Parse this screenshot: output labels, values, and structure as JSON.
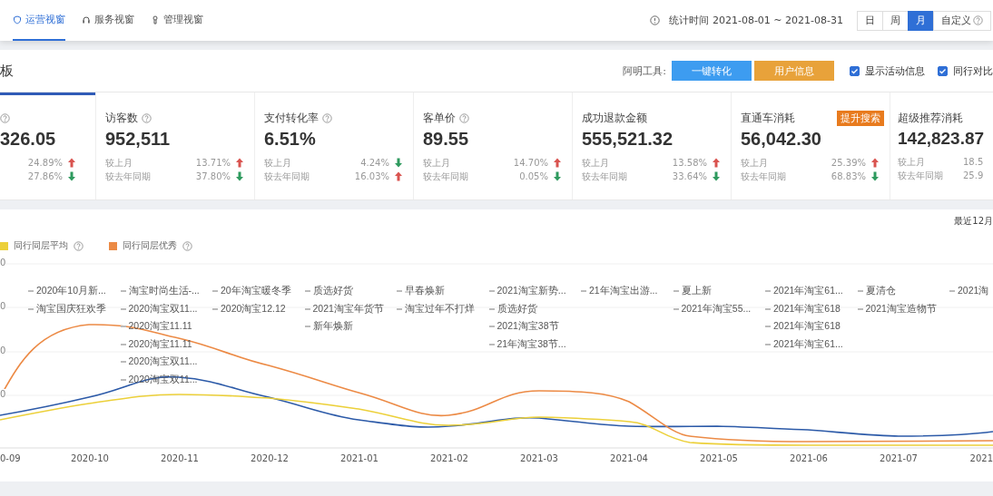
{
  "nav": {
    "tabs": [
      {
        "label": "运营视窗",
        "selected": true
      },
      {
        "label": "服务视窗",
        "selected": false
      },
      {
        "label": "管理视窗",
        "selected": false
      }
    ],
    "stat_time": "统计时间 2021-08-01 ~ 2021-08-31",
    "periods": [
      {
        "label": "日",
        "selected": false
      },
      {
        "label": "周",
        "selected": false
      },
      {
        "label": "月",
        "selected": true
      },
      {
        "label": "自定义",
        "selected": false
      }
    ]
  },
  "toolbar": {
    "title": "板",
    "tools_label": "阿明工具:",
    "buttons": [
      {
        "label": "一键转化",
        "kind": "primary"
      },
      {
        "label": "用户信息",
        "kind": "warning"
      }
    ],
    "checkboxes": [
      {
        "label": "显示活动信息",
        "checked": true
      },
      {
        "label": "同行对比",
        "checked": true
      }
    ]
  },
  "metrics": [
    {
      "selected": true,
      "value": "326.05",
      "rows": [
        {
          "value": "24.89%",
          "rising": true
        },
        {
          "value": "27.86%",
          "rising": false
        }
      ]
    },
    {
      "selected": false,
      "title": "访客数",
      "help": true,
      "value": "952,511",
      "rows": [
        {
          "label": "较上月",
          "value": "13.71%",
          "rising": true
        },
        {
          "label": "较去年同期",
          "value": "37.80%",
          "rising": false
        }
      ]
    },
    {
      "selected": false,
      "title": "支付转化率",
      "help": true,
      "value": "6.51%",
      "rows": [
        {
          "label": "较上月",
          "value": "4.24%",
          "rising": false
        },
        {
          "label": "较去年同期",
          "value": "16.03%",
          "rising": true
        }
      ]
    },
    {
      "selected": false,
      "title": "客单价",
      "help": true,
      "value": "89.55",
      "rows": [
        {
          "label": "较上月",
          "value": "14.70%",
          "rising": true
        },
        {
          "label": "较去年同期",
          "value": "0.05%",
          "rising": false
        }
      ]
    },
    {
      "selected": false,
      "title": "成功退款金额",
      "value": "555,521.32",
      "rows": [
        {
          "label": "较上月",
          "value": "13.58%",
          "rising": true
        },
        {
          "label": "较去年同期",
          "value": "33.64%",
          "rising": false
        }
      ]
    },
    {
      "selected": false,
      "title": "直通车消耗",
      "badge": "提升搜索",
      "value": "56,042.30",
      "rows": [
        {
          "label": "较上月",
          "value": "25.39%",
          "rising": true
        },
        {
          "label": "较去年同期",
          "value": "68.83%",
          "rising": false
        }
      ]
    },
    {
      "selected": false,
      "title": "超级推荐消耗",
      "value": "142,823.87",
      "rows": [
        {
          "label": "较上月",
          "value": "18.5"
        },
        {
          "label": "较去年同期",
          "value": "25.9"
        }
      ]
    }
  ],
  "chart": {
    "corner_label": "最近12月",
    "legend": [
      {
        "label": "同行同层平均",
        "color": "#ecd03a"
      },
      {
        "label": "同行同层优秀",
        "color": "#ec8a45"
      }
    ],
    "y_tick_fragments": [
      "0",
      "0",
      "0",
      "0"
    ],
    "event_columns": [
      [
        "2020年10月新...",
        "淘宝国庆狂欢季"
      ],
      [
        "淘宝时尚生活-...",
        "2020淘宝双11...",
        "2020淘宝11.11",
        "2020淘宝11.11",
        "2020淘宝双11...",
        "2020淘宝双11..."
      ],
      [
        "20年淘宝暖冬季",
        "2020淘宝12.12"
      ],
      [
        "质选好货",
        "2021淘宝年货节",
        "新年焕新"
      ],
      [
        "早春焕新",
        "淘宝过年不打烊"
      ],
      [
        "2021淘宝新势...",
        "质选好货",
        "2021淘宝38节",
        "21年淘宝38节..."
      ],
      [
        "21年淘宝出游..."
      ],
      [
        "夏上新",
        "2021年淘宝55..."
      ],
      [
        "2021年淘宝61...",
        "2021年淘宝618",
        "2021年淘宝618",
        "2021年淘宝61..."
      ],
      [
        "夏清仓",
        "2021淘宝造物节"
      ],
      [
        "2021淘"
      ]
    ],
    "x_labels": [
      "0-09",
      "2020-10",
      "2020-11",
      "2020-12",
      "2021-01",
      "2021-02",
      "2021-03",
      "2021-04",
      "2021-05",
      "2021-06",
      "2021-07",
      "2021"
    ]
  }
}
